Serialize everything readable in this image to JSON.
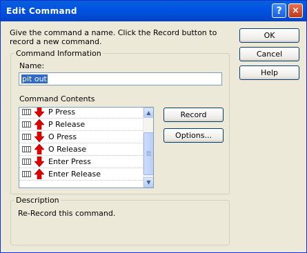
{
  "window": {
    "title": "Edit Command",
    "help_glyph": "?",
    "close_glyph": "×"
  },
  "intro": "Give the command a name.  Click the Record button to record a new command.",
  "buttons": {
    "ok": "OK",
    "cancel": "Cancel",
    "help": "Help",
    "record": "Record",
    "options": "Options..."
  },
  "command_info": {
    "legend": "Command Information",
    "name_label": "Name:",
    "name_value": "pit out"
  },
  "contents": {
    "label": "Command Contents",
    "items": [
      {
        "text": "P Press",
        "direction": "down"
      },
      {
        "text": "P Release",
        "direction": "up"
      },
      {
        "text": "O Press",
        "direction": "down"
      },
      {
        "text": "O Release",
        "direction": "up"
      },
      {
        "text": "Enter Press",
        "direction": "down"
      },
      {
        "text": "Enter Release",
        "direction": "up"
      }
    ],
    "icons": [
      "keyboard-icon",
      "arrow-down-icon",
      "arrow-up-icon"
    ]
  },
  "description": {
    "legend": "Description",
    "text": "Re-Record this command."
  },
  "colors": {
    "titlebar": "#0054e3",
    "selection": "#316ac5",
    "arrow": "#e00000"
  }
}
